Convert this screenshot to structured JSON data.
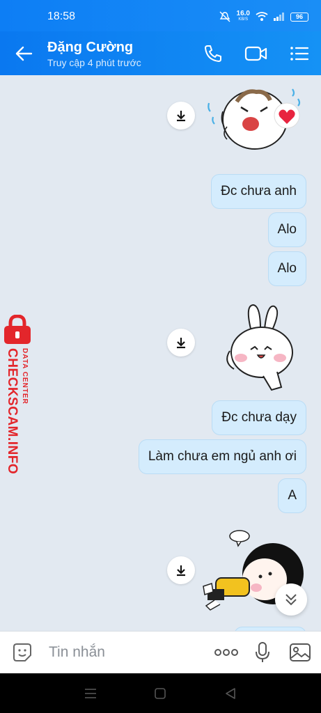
{
  "status_bar": {
    "time": "18:58",
    "net_speed_value": "16.0",
    "net_speed_unit": "KB/S",
    "battery": "96"
  },
  "header": {
    "name": "Đặng Cường",
    "status": "Truy cập 4 phút trước"
  },
  "messages": [
    {
      "text": "Đc chưa anh"
    },
    {
      "text": "Alo"
    },
    {
      "text": "Alo"
    },
    {
      "text": "Đc chưa dạy"
    },
    {
      "text": "Làm chưa em ngủ anh ơi"
    },
    {
      "text": "A"
    }
  ],
  "watermark": {
    "main": "CHECKSCAM.INFO",
    "sub": "DATA CENTER"
  },
  "input": {
    "placeholder": "Tin nhắn"
  },
  "colors": {
    "header_blue": "#0a78f0",
    "bubble_bg": "#d4ecfd",
    "chat_bg": "#e2e9f1",
    "watermark_red": "#e3262b"
  },
  "icons": [
    "back-arrow-icon",
    "phone-icon",
    "video-call-icon",
    "menu-list-icon",
    "download-icon",
    "chevron-double-down-icon",
    "sticker-face-icon",
    "more-dots-icon",
    "microphone-icon",
    "image-icon"
  ]
}
